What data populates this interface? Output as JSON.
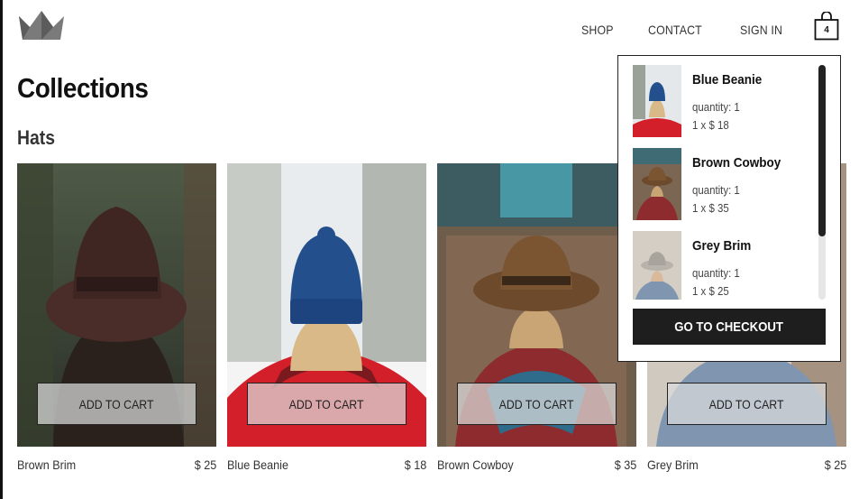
{
  "header": {
    "logo_icon": "crown-icon",
    "nav": [
      {
        "label": "SHOP"
      },
      {
        "label": "CONTACT"
      },
      {
        "label": "SIGN IN"
      }
    ],
    "cart_icon": "shopping-bag-icon",
    "cart_count": "4"
  },
  "page_title": "Collections",
  "section_title": "Hats",
  "products": [
    {
      "name": "Brown Brim",
      "price": "$ 25",
      "button": "ADD TO CART"
    },
    {
      "name": "Blue Beanie",
      "price": "$ 18",
      "button": "ADD TO CART"
    },
    {
      "name": "Brown Cowboy",
      "price": "$ 35",
      "button": "ADD TO CART"
    },
    {
      "name": "Grey Brim",
      "price": "$ 25",
      "button": "ADD TO CART"
    }
  ],
  "cart": {
    "items": [
      {
        "name": "Blue Beanie",
        "quantity": "quantity: 1",
        "line": "1 x $ 18"
      },
      {
        "name": "Brown Cowboy",
        "quantity": "quantity: 1",
        "line": "1 x $ 35"
      },
      {
        "name": "Grey Brim",
        "quantity": "quantity: 1",
        "line": "1 x $ 25"
      }
    ],
    "checkout_label": "GO TO CHECKOUT"
  },
  "colors": {
    "text": "#111111",
    "checkout_bg": "#1e1e1e",
    "button_overlay": "#dcdcdc"
  }
}
